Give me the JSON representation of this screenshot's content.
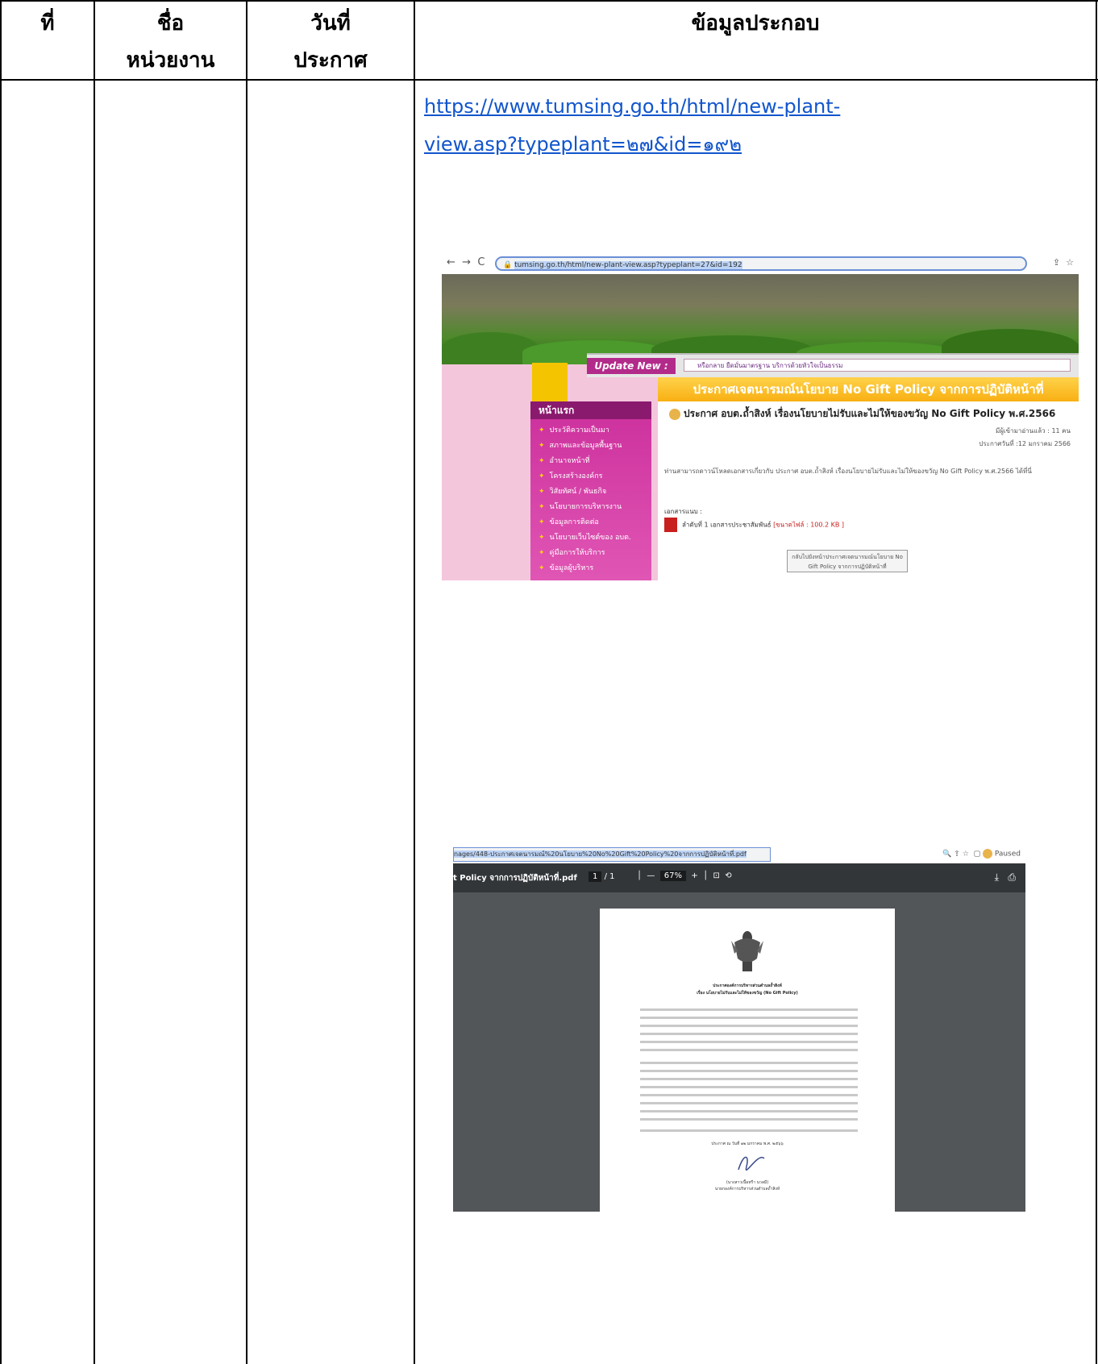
{
  "table": {
    "headers": {
      "no": "ที่",
      "agency_line1": "ชื่อ",
      "agency_line2": "หน่วยงาน",
      "date_line1": "วันที่",
      "date_line2": "ประกาศ",
      "details": "ข้อมูลประกอบ"
    }
  },
  "link": {
    "line1": "https://www.tumsing.go.th/html/new-plant-",
    "line2": "view.asp?typeplant=๒๗&id=๑๙๒"
  },
  "browser_shot": {
    "address": "tumsing.go.th/html/new-plant-view.asp?typeplant=27&id=192",
    "update_label": "Update New :",
    "ticker": "หรือกลาย ยืดมั่นมาตรฐาน บริการด้วยหัวใจเป็นธรรม",
    "banner_title": "ประกาศเจตนารมณ์นโยบาย No Gift Policy จากการปฏิบัติหน้าที่",
    "heading": "ประกาศ อบต.ถ้ำสิงห์ เรื่องนโยบายไม่รับและไม่ให้ของขวัญ No Gift Policy พ.ศ.2566",
    "readers": "มีผู้เข้ามาอ่านแล้ว : 11 คน",
    "announce_date": "ประกาศวันที่ :12 มกราคม 2566",
    "body": "ท่านสามารถดาวน์โหลดเอกสารเกี่ยวกับ ประกาศ อบต.ถ้ำสิงห์ เรื่องนโยบายไม่รับและไม่ให้ของขวัญ No Gift Policy พ.ศ.2566 ได้ที่นี่",
    "attach_label": "เอกสารแนบ :",
    "attach_item": "ลำดับที่ 1 เอกสารประชาสัมพันธ์",
    "attach_size": "[ขนาดไฟล์ : 100.2 KB ]",
    "back_button": "กลับไปยังหน้าประกาศเจตนารมณ์นโยบาย No Gift Policy จากการปฏิบัติหน้าที่",
    "menu_head": "หน้าแรก",
    "menu_items": [
      "ประวัติความเป็นมา",
      "สภาพและข้อมูลพื้นฐาน",
      "อำนาจหน้าที่",
      "โครงสร้างองค์กร",
      "วิสัยทัศน์ / พันธกิจ",
      "นโยบายการบริหารงาน",
      "ข้อมูลการติดต่อ",
      "นโยบายเว็บไซต์ของ อบต.",
      "คู่มือการให้บริการ",
      "ข้อมูลผู้บริหาร"
    ]
  },
  "pdf_shot": {
    "address": "nages/448-ประกาศเจตนารมณ์%20นโยบาย%20No%20Gift%20Policy%20จากการปฏิบัติหน้าที่.pdf",
    "paused": "Paused",
    "filename": "t Policy จากการปฏิบัติหน้าที่.pdf",
    "page": "1",
    "page_total": "/ 1",
    "zoom": "67%",
    "doc_title1": "ประกาศองค์การบริหารส่วนตำบลถ้ำสิงห์",
    "doc_title2": "เรื่อง นโยบายไม่รับและไม่ให้ของขวัญ (No Gift Policy)",
    "doc_date": "ประกาศ ณ วันที่ ๑๒ มกราคม พ.ศ. ๒๕๖๖",
    "signer_name": "(นางสาวเนื้อหรีา นวลมี)",
    "signer_title": "นายกองค์การบริหารส่วนตำบลถ้ำสิงห์"
  }
}
